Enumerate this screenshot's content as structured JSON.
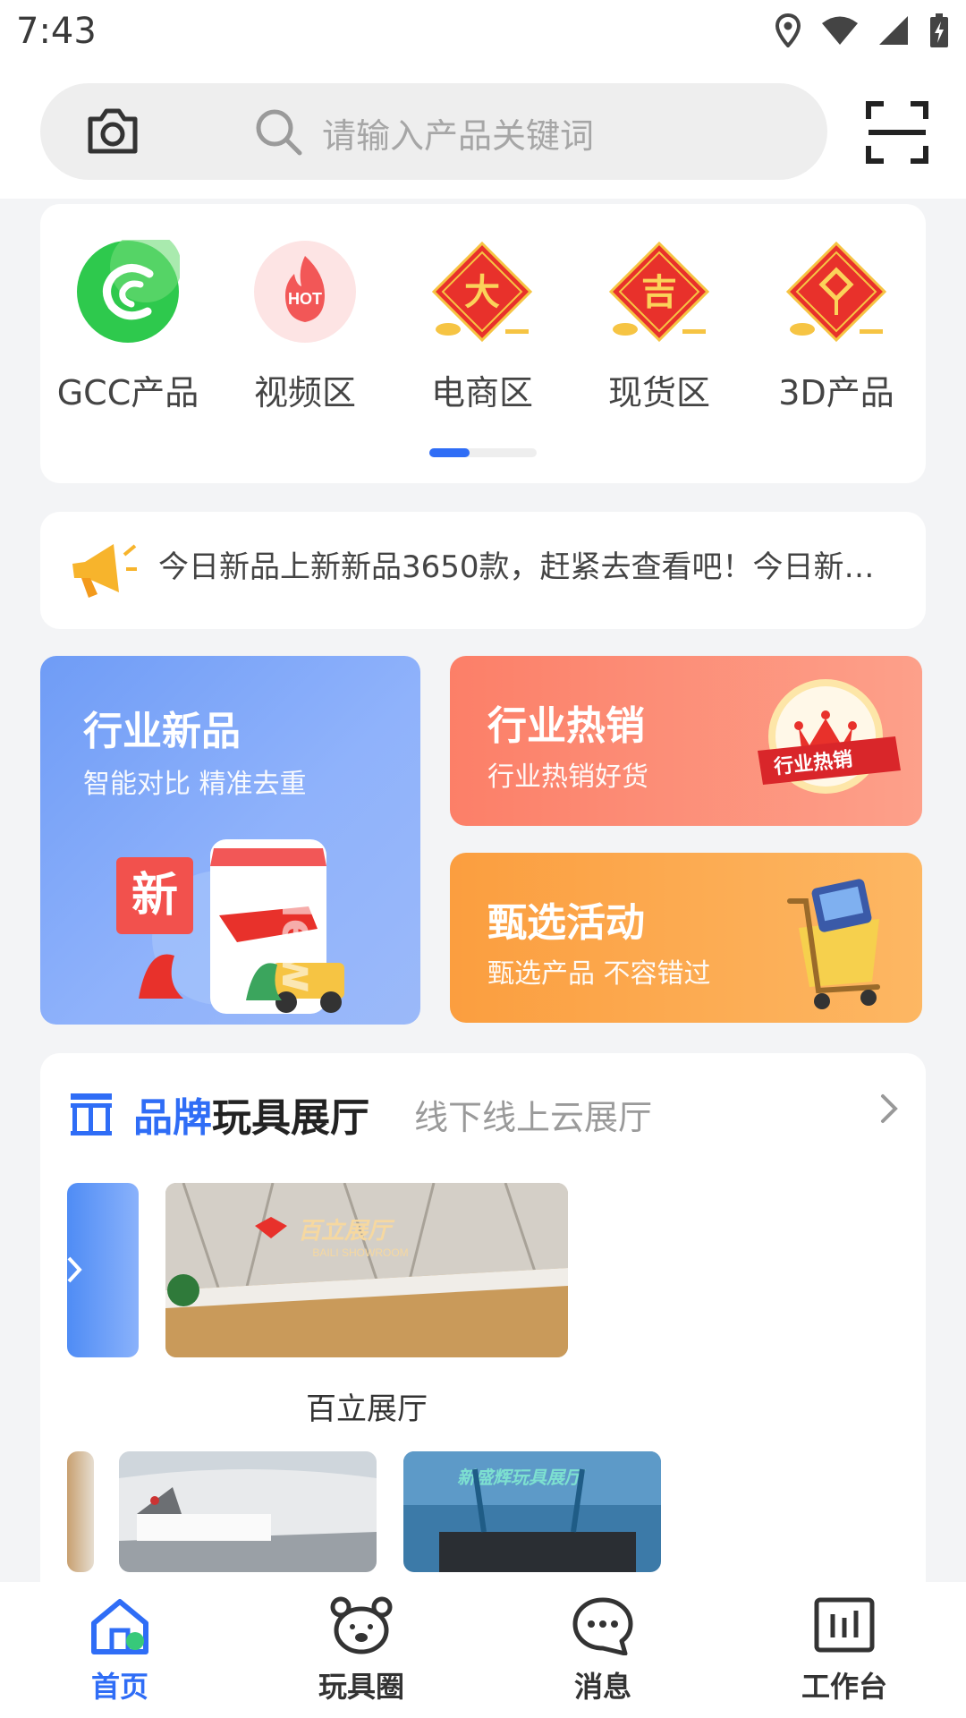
{
  "status_bar": {
    "time": "7:43"
  },
  "search": {
    "placeholder": "请输入产品关键词"
  },
  "categories": [
    {
      "label": "GCC产品",
      "icon": "gcc-logo-icon"
    },
    {
      "label": "视频区",
      "icon": "hot-flame-icon",
      "badge": "HOT"
    },
    {
      "label": "电商区",
      "icon": "da-diamond-icon",
      "glyph": "大"
    },
    {
      "label": "现货区",
      "icon": "ji-diamond-icon",
      "glyph": "吉"
    },
    {
      "label": "3D产品",
      "icon": "chinese-knot-icon"
    }
  ],
  "notice": {
    "text": "今日新品上新新品3650款，赶紧去查看吧！今日新…"
  },
  "promos": {
    "new": {
      "title": "行业新品",
      "subtitle": "智能对比  精准去重",
      "badge": "新",
      "watermark": "New"
    },
    "hot": {
      "title": "行业热销",
      "subtitle": "行业热销好货",
      "ribbon": "行业热销"
    },
    "selected": {
      "title": "甄选活动",
      "subtitle": "甄选产品 不容错过"
    }
  },
  "brand": {
    "title_highlight": "品牌",
    "title_rest": "玩具展厅",
    "subtitle": "线下线上云展厅",
    "featured": {
      "caption": "百立展厅",
      "sign_text": "百立展厅",
      "sign_sub": "BAILI SHOWROOM"
    },
    "second_row_sign": "新盛辉玩具展厅"
  },
  "nav": [
    {
      "label": "首页",
      "icon": "home-icon",
      "active": true
    },
    {
      "label": "玩具圈",
      "icon": "bear-icon",
      "active": false
    },
    {
      "label": "消息",
      "icon": "chat-bubble-icon",
      "active": false
    },
    {
      "label": "工作台",
      "icon": "dashboard-icon",
      "active": false
    }
  ],
  "colors": {
    "accent": "#2f6df6",
    "festive_red": "#e8312b",
    "gold": "#f6c443"
  }
}
